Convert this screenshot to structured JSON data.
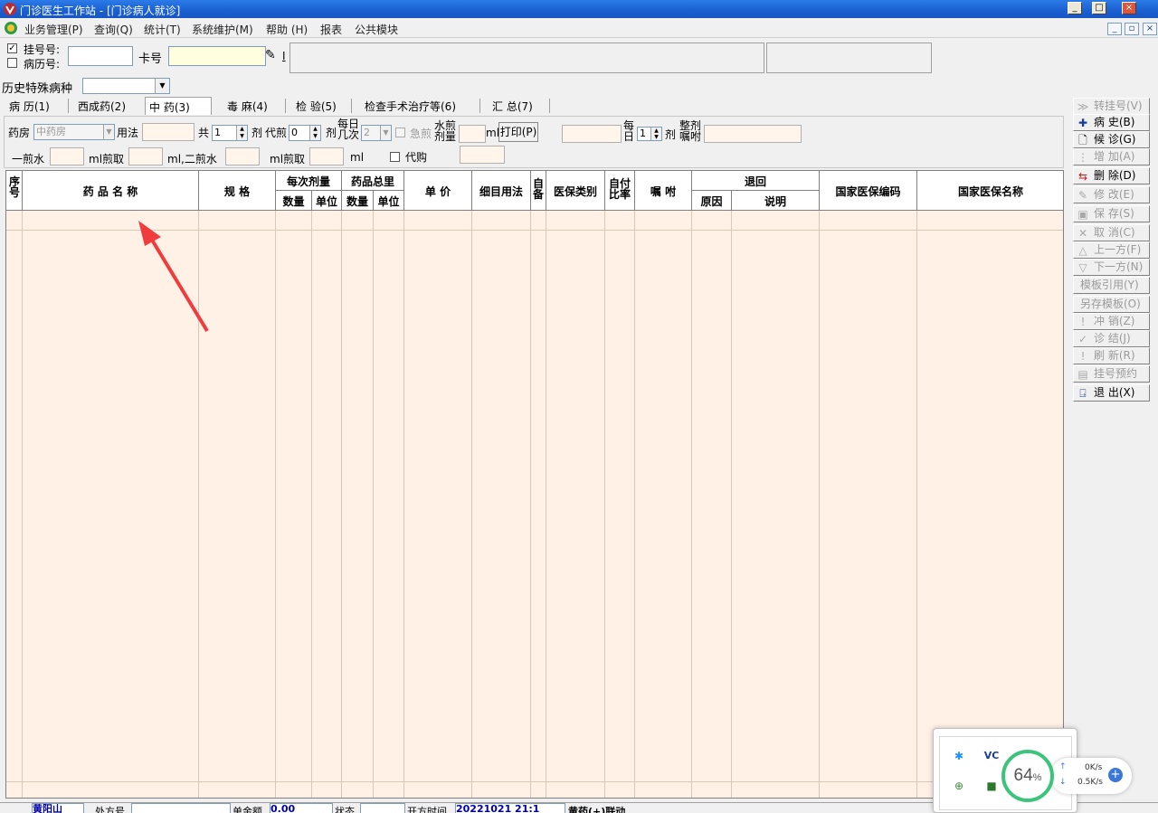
{
  "window": {
    "title": "门诊医生工作站 - [门诊病人就诊]"
  },
  "menu": [
    "业务管理(P)",
    "查询(Q)",
    "统计(T)",
    "系统维护(M)",
    "帮助 (H)",
    "报表",
    "公共模块"
  ],
  "top": {
    "reg_no_label": "挂号号:",
    "record_no_label": "病历号:",
    "card_label": "卡号",
    "reg_no_checked": true,
    "record_no_checked": false
  },
  "history": {
    "label": "历史特殊病种"
  },
  "tabs": [
    "病 历(1)",
    "西成药(2)",
    "中 药(3)",
    "毒 麻(4)",
    "检 验(5)",
    "检查手术治疗等(6)",
    "汇 总(7)"
  ],
  "active_tab": 2,
  "form": {
    "pharmacy_label": "药房",
    "pharmacy_value": "中药房",
    "usage_label": "用法",
    "total_label": "共",
    "total_value": "1",
    "dose_unit_1": "剂",
    "decoct_label": "代煎",
    "decoct_value": "0",
    "dose_unit_2": "剂",
    "daily_times_label": "每日几次",
    "daily_times_value": "2",
    "urgent_label": "急煎",
    "water_label": "水煎剂量",
    "ml_label": "ml",
    "print_button": "打印(P)",
    "per_day_label": "每日",
    "per_day_value": "1",
    "dose_unit_3": "剂",
    "whole_dose_label": "整剂嘱咐",
    "first_water_label": "一煎水",
    "ml_first_take": "ml煎取",
    "ml_second_water": "ml,二煎水",
    "ml_second_take": "ml煎取",
    "ml_end": "ml",
    "proxy_label": "代购"
  },
  "table": {
    "headers": {
      "seq": "序号",
      "name": "药 品 名 称",
      "spec": "规 格",
      "per_dose": "每次剂量",
      "per_dose_qty": "数量",
      "per_dose_unit": "单位",
      "total": "药品总里",
      "total_qty": "数量",
      "total_unit": "单位",
      "price": "单 价",
      "usage": "细目用法",
      "self_prep": "自备",
      "insurance_type": "医保类别",
      "self_pay_ratio": "自付比率",
      "instruction": "嘱 咐",
      "return": "退回",
      "return_reason": "原因",
      "return_note": "说明",
      "nat_code": "国家医保编码",
      "nat_name": "国家医保名称"
    },
    "rows": []
  },
  "sidebar": [
    {
      "label": "转挂号(V)",
      "icon": "transfer-icon",
      "enabled": false
    },
    {
      "label": "病 史(B)",
      "icon": "plus-icon",
      "enabled": true
    },
    {
      "label": "候 诊(G)",
      "icon": "document-icon",
      "enabled": true
    },
    {
      "label": "增 加(A)",
      "icon": "add-icon",
      "enabled": false
    },
    {
      "label": "删 除(D)",
      "icon": "delete-icon",
      "enabled": true
    },
    {
      "label": "修 改(E)",
      "icon": "edit-icon",
      "enabled": false
    },
    {
      "label": "保 存(S)",
      "icon": "save-icon",
      "enabled": false
    },
    {
      "label": "取 消(C)",
      "icon": "cancel-icon",
      "enabled": false
    },
    {
      "label": "上一方(F)",
      "icon": "up-icon",
      "enabled": false
    },
    {
      "label": "下一方(N)",
      "icon": "down-icon",
      "enabled": false
    },
    {
      "label": "模板引用(Y)",
      "icon": "",
      "enabled": false
    },
    {
      "label": "另存模板(O)",
      "icon": "",
      "enabled": false
    },
    {
      "label": "冲 销(Z)",
      "icon": "reverse-icon",
      "enabled": false
    },
    {
      "label": "诊 结(J)",
      "icon": "check-icon",
      "enabled": false
    },
    {
      "label": "刷 新(R)",
      "icon": "refresh-icon",
      "enabled": false
    },
    {
      "label": "挂号预约",
      "icon": "calendar-icon",
      "enabled": false
    },
    {
      "label": "退 出(X)",
      "icon": "exit-icon",
      "enabled": true
    }
  ],
  "status": {
    "field1_value": "黄阳山",
    "field2_label": "处方号",
    "amount_label": "单金额",
    "amount_value": "0.00",
    "status_label": "状态",
    "open_time_label": "开方时间",
    "open_time_value": "20221021 21:1",
    "last_value": "黄药(+)联动"
  },
  "widget": {
    "percent": "64",
    "percent_sign": "%",
    "up_speed": "0K/s",
    "down_speed": "0.5K/s"
  },
  "colors": {
    "grid_bg": "#fff1e6",
    "titlebar": "#1a5fd0",
    "annotation_arrow": "#f03c3c",
    "gauge": "#3cc47c"
  }
}
